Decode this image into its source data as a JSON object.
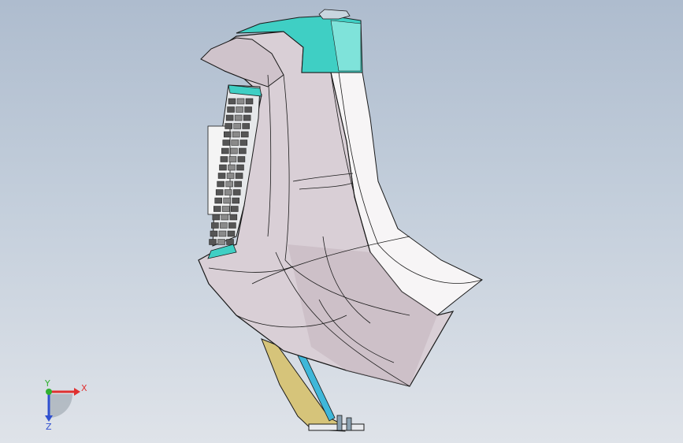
{
  "viewport": {
    "background_top": "#aebcce",
    "background_bottom": "#dfe3e9"
  },
  "model": {
    "body_color": "#d9cfd6",
    "body_shade": "#c2b5be",
    "top_cap_color": "#3fcfc4",
    "edge_color": "#1a1a1a",
    "side_face_color": "#f7f5f6",
    "bracket_color": "#d6c47a",
    "bracket_accent": "#3fb7d9",
    "grille_color": "#555555"
  },
  "triad": {
    "x_label": "X",
    "y_label": "Y",
    "z_label": "Z",
    "x_color": "#e03030",
    "y_color": "#30b030",
    "z_color": "#3050d0"
  }
}
